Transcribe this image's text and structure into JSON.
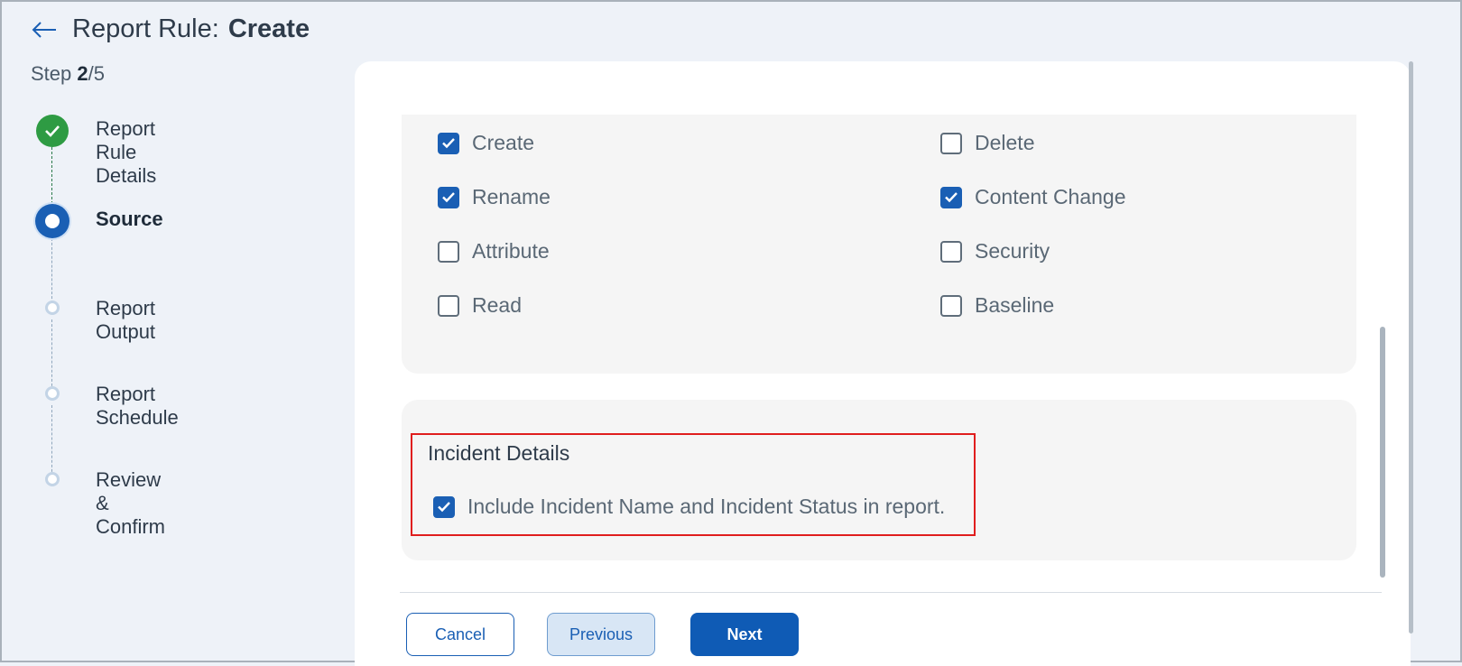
{
  "header": {
    "title_prefix": "Report Rule:",
    "title_action": "Create",
    "step_prefix": "Step ",
    "step_current": "2",
    "step_total": "/5"
  },
  "stepper": {
    "steps": [
      {
        "label": "Report Rule Details",
        "state": "done"
      },
      {
        "label": "Source",
        "state": "active"
      },
      {
        "label": "Report Output",
        "state": "pending"
      },
      {
        "label": "Report Schedule",
        "state": "pending"
      },
      {
        "label": "Review & Confirm",
        "state": "pending"
      }
    ]
  },
  "events": {
    "options": [
      {
        "label": "Create",
        "checked": true
      },
      {
        "label": "Delete",
        "checked": false
      },
      {
        "label": "Rename",
        "checked": true
      },
      {
        "label": "Content Change",
        "checked": true
      },
      {
        "label": "Attribute",
        "checked": false
      },
      {
        "label": "Security",
        "checked": false
      },
      {
        "label": "Read",
        "checked": false
      },
      {
        "label": "Baseline",
        "checked": false
      }
    ]
  },
  "incident": {
    "title": "Incident Details",
    "option_label": "Include Incident Name and Incident Status in report.",
    "option_checked": true
  },
  "footer": {
    "cancel_label": "Cancel",
    "previous_label": "Previous",
    "next_label": "Next"
  },
  "colors": {
    "primary": "#1a5fb4",
    "success": "#2e9b43",
    "highlight": "#e01e1e",
    "background": "#eef2f8"
  }
}
